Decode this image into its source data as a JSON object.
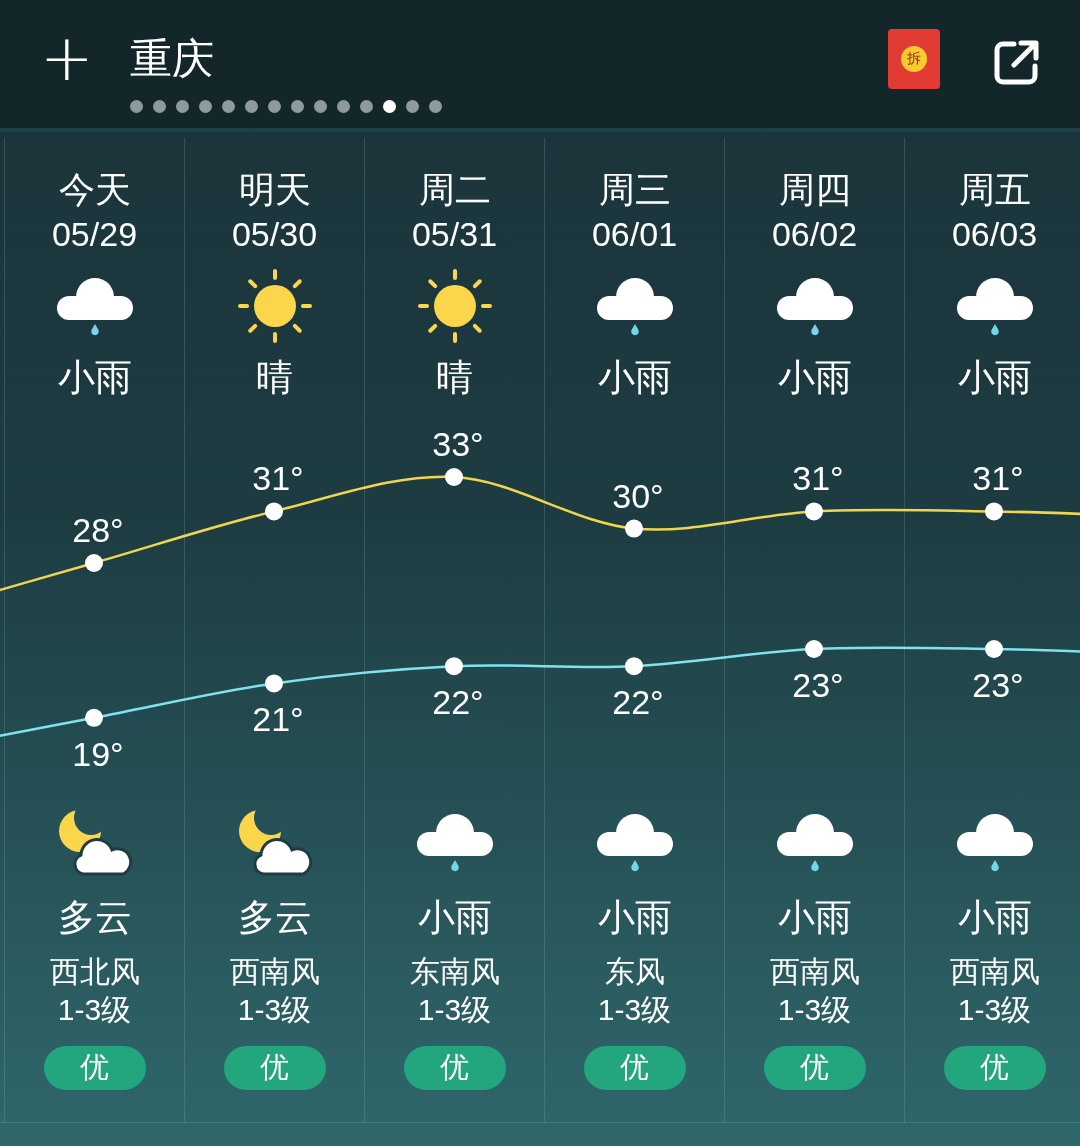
{
  "header": {
    "add_label": "+",
    "city": "重庆",
    "pages": [
      {
        "selected": false
      },
      {
        "selected": false
      },
      {
        "selected": false
      },
      {
        "selected": false
      },
      {
        "selected": false
      },
      {
        "selected": false
      },
      {
        "selected": false
      },
      {
        "selected": false
      },
      {
        "selected": false
      },
      {
        "selected": false
      },
      {
        "selected": false
      },
      {
        "selected": true
      },
      {
        "selected": false
      },
      {
        "selected": false
      }
    ],
    "red_packet": {
      "label": "拆"
    }
  },
  "days": [
    {
      "day": "今天",
      "date": "05/29",
      "day_weather": {
        "kind": "rain",
        "text": "小雨"
      },
      "high": "28°",
      "low": "19°",
      "night_weather": {
        "kind": "cloudy_night",
        "text": "多云"
      },
      "wind": "西北风",
      "wind_level": "1-3级",
      "air_quality": "优"
    },
    {
      "day": "明天",
      "date": "05/30",
      "day_weather": {
        "kind": "sunny",
        "text": "晴"
      },
      "high": "31°",
      "low": "21°",
      "night_weather": {
        "kind": "cloudy_night",
        "text": "多云"
      },
      "wind": "西南风",
      "wind_level": "1-3级",
      "air_quality": "优"
    },
    {
      "day": "周二",
      "date": "05/31",
      "day_weather": {
        "kind": "sunny",
        "text": "晴"
      },
      "high": "33°",
      "low": "22°",
      "night_weather": {
        "kind": "rain",
        "text": "小雨"
      },
      "wind": "东南风",
      "wind_level": "1-3级",
      "air_quality": "优"
    },
    {
      "day": "周三",
      "date": "06/01",
      "day_weather": {
        "kind": "rain",
        "text": "小雨"
      },
      "high": "30°",
      "low": "22°",
      "night_weather": {
        "kind": "rain",
        "text": "小雨"
      },
      "wind": "东风",
      "wind_level": "1-3级",
      "air_quality": "优"
    },
    {
      "day": "周四",
      "date": "06/02",
      "day_weather": {
        "kind": "rain",
        "text": "小雨"
      },
      "high": "31°",
      "low": "23°",
      "night_weather": {
        "kind": "rain",
        "text": "小雨"
      },
      "wind": "西南风",
      "wind_level": "1-3级",
      "air_quality": "优"
    },
    {
      "day": "周五",
      "date": "06/03",
      "day_weather": {
        "kind": "rain",
        "text": "小雨"
      },
      "high": "31°",
      "low": "23°",
      "night_weather": {
        "kind": "rain",
        "text": "小雨"
      },
      "wind": "西南风",
      "wind_level": "1-3级",
      "air_quality": "优"
    }
  ]
}
